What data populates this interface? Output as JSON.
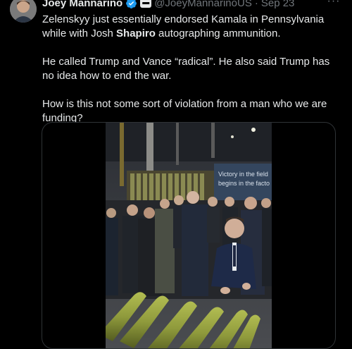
{
  "tweet": {
    "author_name": "Joey Mannarino",
    "handle": "@JoeyMannarinoUS",
    "separator": "·",
    "date": "Sep 23",
    "more_label": "···",
    "paragraph1_before": "Zelenskyy just essentially endorsed Kamala in Pennsylvania while with Josh ",
    "paragraph1_bold": "Shapiro",
    "paragraph1_after": " autographing ammunition.",
    "paragraph2": "He called Trump and Vance “radical”. He also said Trump has no idea how to end the war.",
    "paragraph3": "How is this not some sort of violation from a man who we are funding?"
  },
  "video": {
    "banner_line1": "Victory in the field",
    "banner_line2": "begins in the facto"
  },
  "colors": {
    "verified_blue": "#1d9bf0",
    "muted_text": "#71767b",
    "border": "#2f3336",
    "shell_olive": "#8f9a3c"
  }
}
